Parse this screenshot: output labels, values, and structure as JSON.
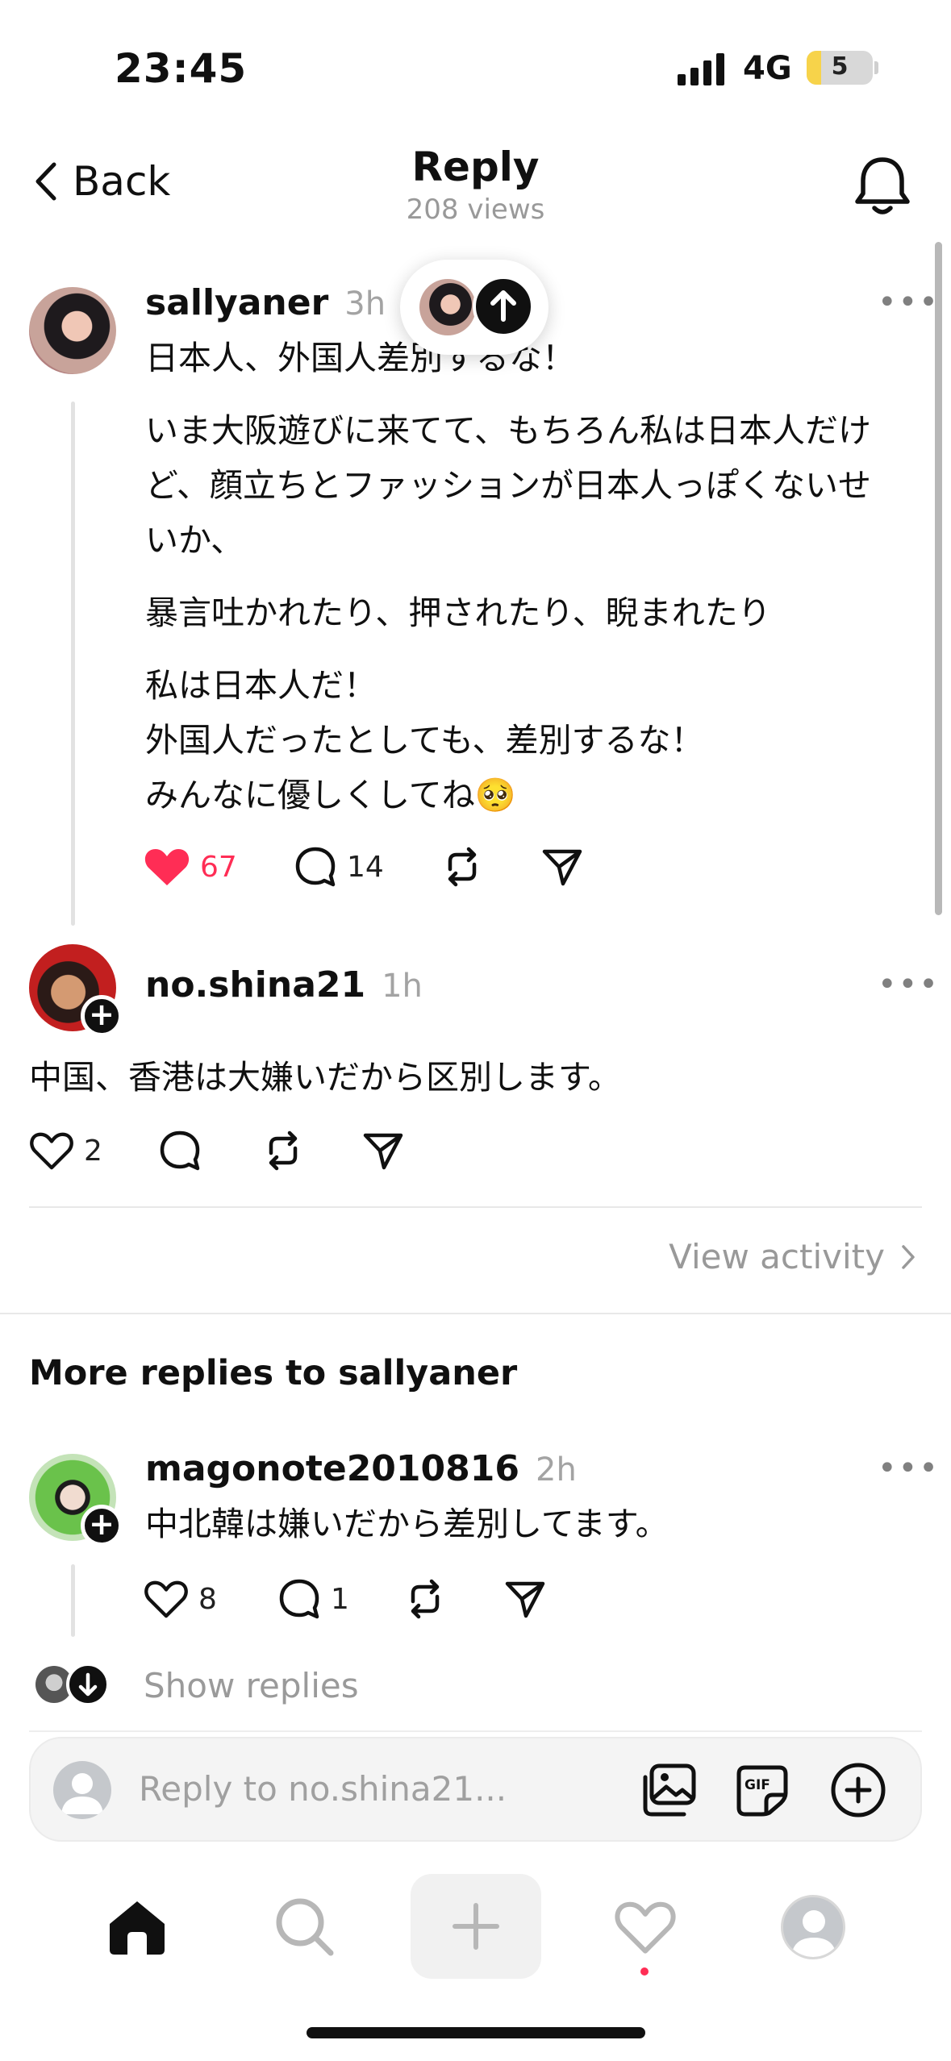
{
  "status_bar": {
    "time": "23:45",
    "network": "4G",
    "battery": "5",
    "battery_fraction": 0.05
  },
  "header": {
    "back_label": "Back",
    "title": "Reply",
    "views": "208 views"
  },
  "original_post": {
    "username": "sallyaner",
    "time": "3h",
    "paragraphs": [
      "日本人、外国人差別するな！",
      "いま大阪遊びに来てて、もちろん私は日本人だけど、顔立ちとファッションが日本人っぽくないせいか、",
      "暴言吐かれたり、押されたり、睨まれたり",
      "私は日本人だ！\n外国人だったとしても、差別するな！\nみんなに優しくしてね🥺"
    ],
    "likes": "67",
    "replies": "14",
    "liked": true
  },
  "reply_post": {
    "username": "no.shina21",
    "time": "1h",
    "text": "中国、香港は大嫌いだから区別します。",
    "likes": "2"
  },
  "view_activity": "View activity",
  "more_replies": {
    "title": "More replies to sallyaner",
    "items": [
      {
        "username": "magonote2010816",
        "time": "2h",
        "text": "中北韓は嫌いだから差別してます。",
        "likes": "8",
        "replies": "1"
      }
    ],
    "show_replies": "Show replies"
  },
  "composer": {
    "placeholder": "Reply to no.shina21..."
  },
  "icons": {
    "header": [
      "chevron-left-icon",
      "bell-icon"
    ],
    "actions": [
      "heart-icon",
      "comment-icon",
      "repost-icon",
      "share-icon"
    ],
    "composer": [
      "photo-library-icon",
      "gif-icon",
      "plus-circle-icon"
    ],
    "tabs": [
      "home-icon",
      "search-icon",
      "plus-icon",
      "heart-icon",
      "profile-icon"
    ]
  },
  "colors": {
    "like": "#ff2d55",
    "text": "#101010",
    "muted": "#999999"
  }
}
